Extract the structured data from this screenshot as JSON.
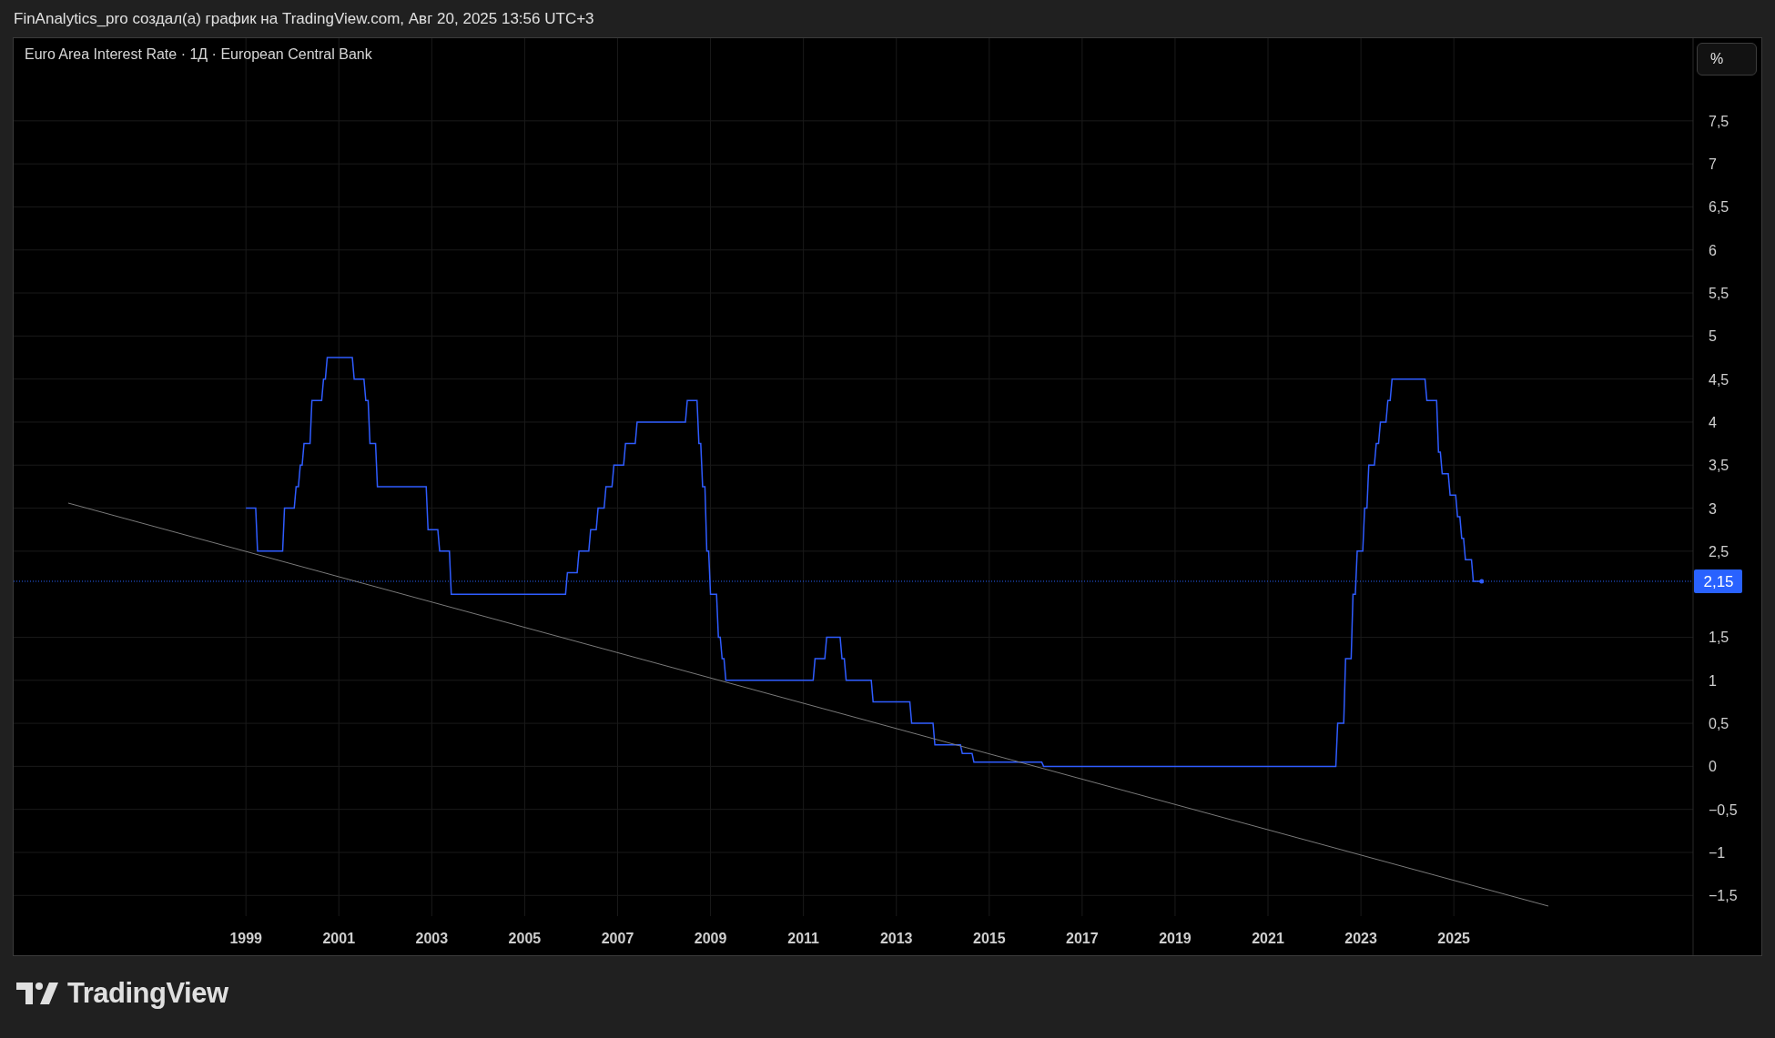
{
  "header": {
    "text": "FinAnalytics_pro создал(а) график на TradingView.com, Авг 20, 2025 13:56 UTC+3"
  },
  "chart": {
    "unit_button": "%",
    "chart_data": {
      "type": "line",
      "grid": true,
      "x": [
        1999.0,
        1999.21,
        1999.25,
        1999.79,
        1999.83,
        2000.04,
        2000.08,
        2000.13,
        2000.17,
        2000.21,
        2000.25,
        2000.38,
        2000.42,
        2000.63,
        2000.67,
        2000.71,
        2000.75,
        2001.29,
        2001.33,
        2001.54,
        2001.58,
        2001.63,
        2001.67,
        2001.79,
        2001.83,
        2002.88,
        2002.92,
        2003.13,
        2003.17,
        2003.38,
        2003.42,
        2005.88,
        2005.92,
        2006.13,
        2006.17,
        2006.38,
        2006.42,
        2006.54,
        2006.58,
        2006.71,
        2006.75,
        2006.88,
        2006.92,
        2007.13,
        2007.17,
        2007.38,
        2007.42,
        2008.46,
        2008.5,
        2008.71,
        2008.75,
        2008.79,
        2008.83,
        2008.88,
        2008.92,
        2008.96,
        2009.0,
        2009.13,
        2009.17,
        2009.21,
        2009.25,
        2009.29,
        2009.33,
        2011.21,
        2011.25,
        2011.46,
        2011.5,
        2011.79,
        2011.83,
        2011.88,
        2011.92,
        2012.46,
        2012.5,
        2013.29,
        2013.33,
        2013.79,
        2013.83,
        2014.38,
        2014.42,
        2014.63,
        2014.67,
        2016.13,
        2016.17,
        2022.46,
        2022.5,
        2022.63,
        2022.67,
        2022.79,
        2022.83,
        2022.88,
        2022.92,
        2023.04,
        2023.08,
        2023.13,
        2023.17,
        2023.29,
        2023.33,
        2023.38,
        2023.42,
        2023.54,
        2023.58,
        2023.63,
        2023.67,
        2024.38,
        2024.42,
        2024.63,
        2024.67,
        2024.71,
        2024.75,
        2024.88,
        2024.92,
        2025.04,
        2025.08,
        2025.13,
        2025.17,
        2025.21,
        2025.25,
        2025.38,
        2025.42,
        2025.6
      ],
      "series": [
        {
          "name": "Euro Area Interest Rate · 1Д · European Central Bank",
          "color": "#2f5cff",
          "values": [
            3.0,
            3.0,
            2.5,
            2.5,
            3.0,
            3.0,
            3.25,
            3.25,
            3.5,
            3.5,
            3.75,
            3.75,
            4.25,
            4.25,
            4.5,
            4.5,
            4.75,
            4.75,
            4.5,
            4.5,
            4.25,
            4.25,
            3.75,
            3.75,
            3.25,
            3.25,
            2.75,
            2.75,
            2.5,
            2.5,
            2.0,
            2.0,
            2.25,
            2.25,
            2.5,
            2.5,
            2.75,
            2.75,
            3.0,
            3.0,
            3.25,
            3.25,
            3.5,
            3.5,
            3.75,
            3.75,
            4.0,
            4.0,
            4.25,
            4.25,
            3.75,
            3.75,
            3.25,
            3.25,
            2.5,
            2.5,
            2.0,
            2.0,
            1.5,
            1.5,
            1.25,
            1.25,
            1.0,
            1.0,
            1.25,
            1.25,
            1.5,
            1.5,
            1.25,
            1.25,
            1.0,
            1.0,
            0.75,
            0.75,
            0.5,
            0.5,
            0.25,
            0.25,
            0.15,
            0.15,
            0.05,
            0.05,
            0.0,
            0.0,
            0.5,
            0.5,
            1.25,
            1.25,
            2.0,
            2.0,
            2.5,
            2.5,
            3.0,
            3.0,
            3.5,
            3.5,
            3.75,
            3.75,
            4.0,
            4.0,
            4.25,
            4.25,
            4.5,
            4.5,
            4.25,
            4.25,
            3.65,
            3.65,
            3.4,
            3.4,
            3.15,
            3.15,
            2.9,
            2.9,
            2.65,
            2.65,
            2.4,
            2.4,
            2.15,
            2.15
          ]
        }
      ],
      "xlim": [
        1994.0,
        2030.15
      ],
      "ylim": [
        -1.74,
        8.46
      ],
      "xticks": [
        1999,
        2001,
        2003,
        2005,
        2007,
        2009,
        2011,
        2013,
        2015,
        2017,
        2019,
        2021,
        2023,
        2025
      ],
      "yticks": [
        {
          "value": -1.5,
          "label": "−1,5"
        },
        {
          "value": -1,
          "label": "−1"
        },
        {
          "value": -0.5,
          "label": "−0,5"
        },
        {
          "value": 0,
          "label": "0"
        },
        {
          "value": 0.5,
          "label": "0,5"
        },
        {
          "value": 1,
          "label": "1"
        },
        {
          "value": 1.5,
          "label": "1,5"
        },
        {
          "value": 2.5,
          "label": "2,5"
        },
        {
          "value": 3,
          "label": "3"
        },
        {
          "value": 3.5,
          "label": "3,5"
        },
        {
          "value": 4,
          "label": "4"
        },
        {
          "value": 4.5,
          "label": "4,5"
        },
        {
          "value": 5,
          "label": "5"
        },
        {
          "value": 5.5,
          "label": "5,5"
        },
        {
          "value": 6,
          "label": "6"
        },
        {
          "value": 6.5,
          "label": "6,5"
        },
        {
          "value": 7,
          "label": "7"
        },
        {
          "value": 7.5,
          "label": "7,5"
        }
      ],
      "ref_lines": [
        {
          "axis": "y",
          "value": 2.15,
          "label": "2,15",
          "color": "#2962ff"
        }
      ]
    }
  },
  "footer": {
    "logo_text": "TradingView"
  }
}
